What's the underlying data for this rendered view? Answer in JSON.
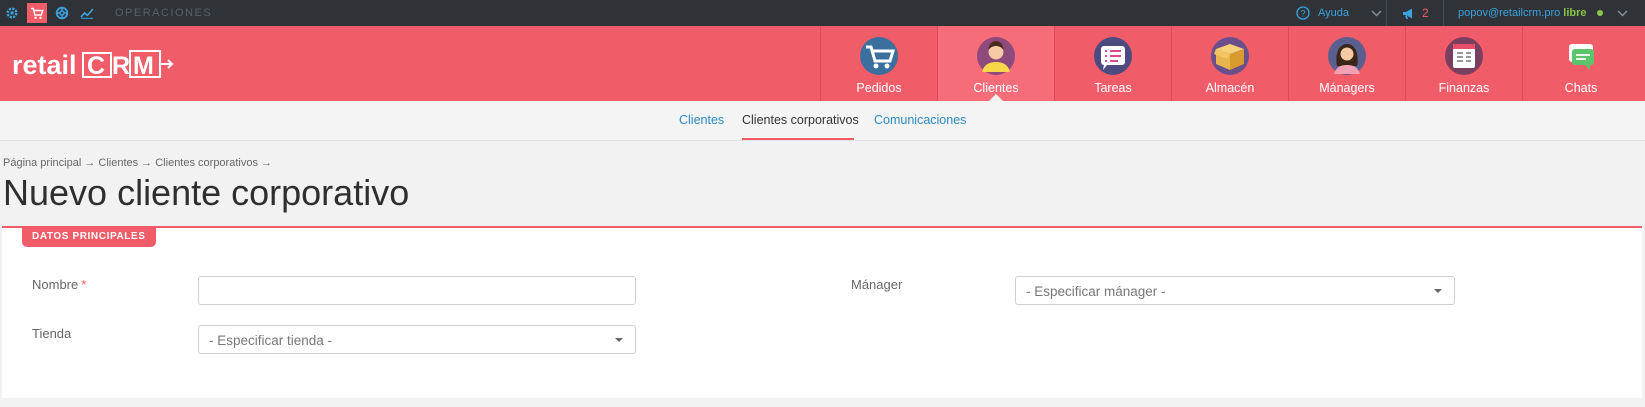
{
  "topbar": {
    "operations_label": "OPERACIONES",
    "help_label": "Ayuda",
    "notifications_count": "2",
    "user_email": "popov@retailcrm.pro",
    "user_status": "libre"
  },
  "header": {
    "logo_text": "retailCRM",
    "nav": [
      {
        "label": "Pedidos",
        "icon": "cart-icon"
      },
      {
        "label": "Clientes",
        "icon": "customer-icon"
      },
      {
        "label": "Tareas",
        "icon": "tasks-icon"
      },
      {
        "label": "Almacén",
        "icon": "warehouse-box-icon"
      },
      {
        "label": "Mánagers",
        "icon": "manager-icon"
      },
      {
        "label": "Finanzas",
        "icon": "finance-icon"
      },
      {
        "label": "Chats",
        "icon": "chat-icon"
      }
    ]
  },
  "subnav": {
    "tabs": [
      "Clientes",
      "Clientes corporativos",
      "Comunicaciones"
    ]
  },
  "breadcrumb": "Página principal → Clientes → Clientes corporativos →",
  "page_title": "Nuevo cliente corporativo",
  "section": {
    "title": "DATOS PRINCIPALES",
    "name_label": "Nombre",
    "required_mark": "*",
    "name_value": "",
    "manager_label": "Mánager",
    "manager_placeholder": "- Especificar mánager -",
    "store_label": "Tienda",
    "store_placeholder": "- Especificar tienda -"
  },
  "colors": {
    "brand_red": "#f05d69",
    "link_blue": "#2b8ac4",
    "status_green": "#8bc34a"
  }
}
